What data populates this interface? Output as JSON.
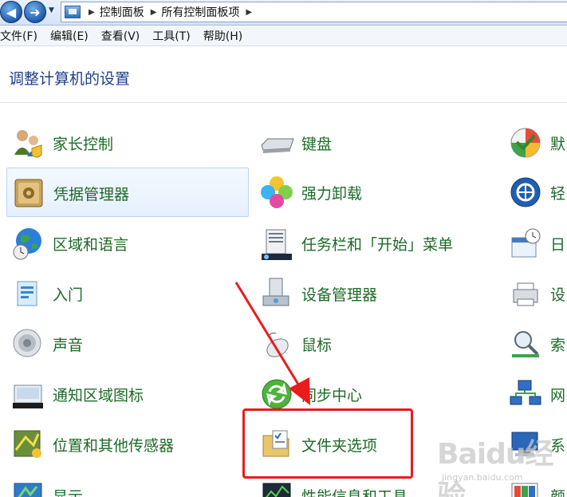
{
  "address": {
    "crumbs": [
      "控制面板",
      "所有控制面板项"
    ]
  },
  "menubar": {
    "items": [
      "文件(F)",
      "编辑(E)",
      "查看(V)",
      "工具(T)",
      "帮助(H)"
    ]
  },
  "heading": "调整计算机的设置",
  "items": {
    "col1": [
      "家长控制",
      "凭据管理器",
      "区域和语言",
      "入门",
      "声音",
      "通知区域图标",
      "位置和其他传感器",
      "显示"
    ],
    "col2": [
      "键盘",
      "强力卸载",
      "任务栏和「开始」菜单",
      "设备管理器",
      "鼠标",
      "同步中心",
      "文件夹选项",
      "性能信息和工具"
    ],
    "col3": [
      "默",
      "轻",
      "日",
      "设",
      "索",
      "网",
      "系",
      "颜"
    ]
  },
  "icons": {
    "col1": [
      "parental-controls-icon",
      "credential-manager-icon",
      "region-language-icon",
      "getting-started-icon",
      "sound-icon",
      "notification-area-icon",
      "location-sensors-icon",
      "display-icon"
    ],
    "col2": [
      "keyboard-icon",
      "uninstaller-icon",
      "taskbar-start-menu-icon",
      "device-manager-icon",
      "mouse-icon",
      "sync-center-icon",
      "folder-options-icon",
      "performance-icon"
    ],
    "col3": [
      "default-programs-icon",
      "ease-of-access-icon",
      "date-time-icon",
      "devices-printers-icon",
      "indexing-options-icon",
      "network-icon",
      "system-icon",
      "color-management-icon"
    ]
  },
  "colors": {
    "heading": "#1e3f8a",
    "item_label": "#1c6a26",
    "highlight": "#e81c1c"
  },
  "watermark": {
    "title": "Baidu经验",
    "sub": "jingyan.baidu.com"
  }
}
